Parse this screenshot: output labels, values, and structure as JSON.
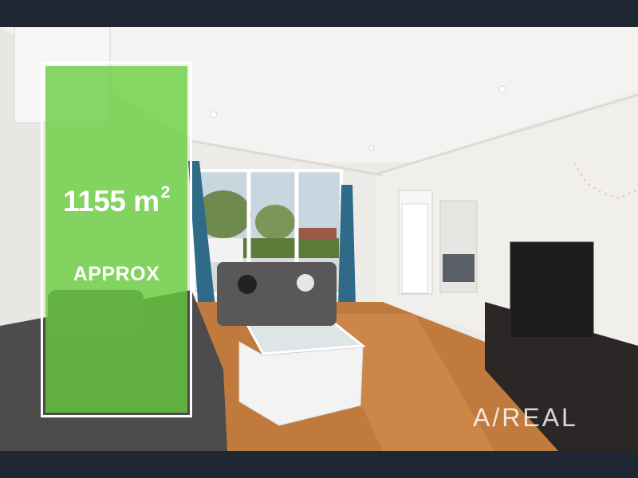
{
  "listing": {
    "area_value": "1155 m",
    "area_unit_superscript": "2",
    "area_qualifier": "APPROX"
  },
  "brand": {
    "watermark": "A/REAL"
  },
  "colors": {
    "frame": "#1f2733",
    "badge_green": "#66cd3c",
    "badge_border": "#ffffff"
  }
}
